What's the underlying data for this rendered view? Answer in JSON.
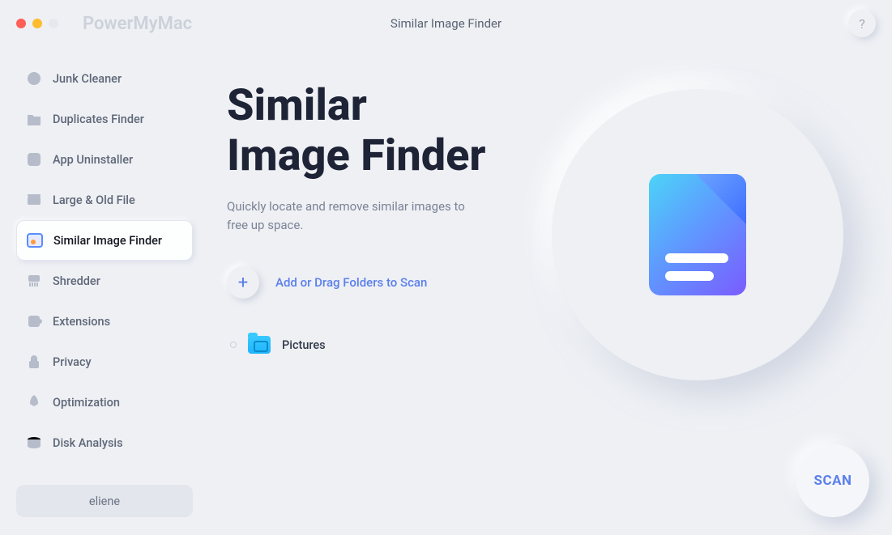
{
  "app_name": "PowerMyMac",
  "header_title": "Similar Image Finder",
  "help": "?",
  "user": "eliene",
  "sidebar": {
    "items": [
      {
        "label": "Junk Cleaner"
      },
      {
        "label": "Duplicates Finder"
      },
      {
        "label": "App Uninstaller"
      },
      {
        "label": "Large & Old File"
      },
      {
        "label": "Similar Image Finder"
      },
      {
        "label": "Shredder"
      },
      {
        "label": "Extensions"
      },
      {
        "label": "Privacy"
      },
      {
        "label": "Optimization"
      },
      {
        "label": "Disk Analysis"
      }
    ]
  },
  "main": {
    "title_line1": "Similar",
    "title_line2": "Image Finder",
    "subtitle": "Quickly locate and remove similar images to free up space.",
    "add_label": "Add or Drag Folders to Scan"
  },
  "folders": [
    {
      "name": "Pictures"
    }
  ],
  "scan_label": "SCAN"
}
